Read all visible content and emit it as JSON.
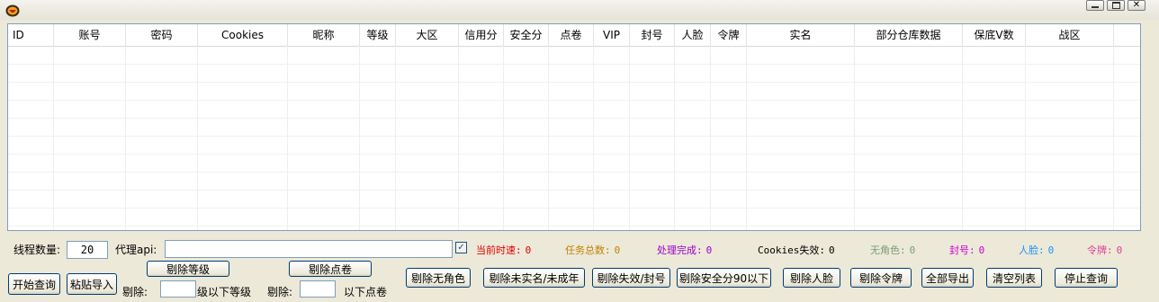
{
  "window": {
    "controls": [
      "minimize",
      "maximize",
      "close"
    ]
  },
  "table": {
    "columns": [
      "ID",
      "账号",
      "密码",
      "Cookies",
      "昵称",
      "等级",
      "大区",
      "信用分",
      "安全分",
      "点卷",
      "VIP",
      "封号",
      "人脸",
      "令牌",
      "实名",
      "部分仓库数据",
      "保底V数",
      "战区"
    ],
    "rows": []
  },
  "settings": {
    "threads_label": "线程数量:",
    "threads_value": "20",
    "proxy_label": "代理api:",
    "proxy_value": "",
    "proxy_checked": true
  },
  "stats": [
    {
      "label": "当前时速:",
      "value": "0",
      "color": "#e00000"
    },
    {
      "label": "任务总数:",
      "value": "0",
      "color": "#c08000"
    },
    {
      "label": "处理完成:",
      "value": "0",
      "color": "#9a00c8"
    },
    {
      "label": "Cookies失效:",
      "value": "0",
      "color": "#000000"
    },
    {
      "label": "无角色:",
      "value": "0",
      "color": "#7a9a7a"
    },
    {
      "label": "封号:",
      "value": "0",
      "color": "#d000d0"
    },
    {
      "label": "人脸:",
      "value": "0",
      "color": "#1e90ff"
    },
    {
      "label": "令牌:",
      "value": "0",
      "color": "#e0409a"
    }
  ],
  "filters": {
    "remove_level_button": "剔除等级",
    "remove_level_prefix": "剔除:",
    "remove_level_value": "",
    "remove_level_suffix": "级以下等级",
    "remove_points_button": "剔除点卷",
    "remove_points_prefix": "剔除:",
    "remove_points_value": "",
    "remove_points_suffix": "以下点卷"
  },
  "buttons": {
    "start": "开始查询",
    "paste_import": "粘贴导入",
    "remove_no_role": "剔除无角色",
    "remove_unverified": "剔除未实名/未成年",
    "remove_invalid_banned": "剔除失效/封号",
    "remove_low_security": "剔除安全分90以下",
    "remove_face": "剔除人脸",
    "remove_token": "剔除令牌",
    "export_all": "全部导出",
    "clear_list": "清空列表",
    "stop": "停止查询"
  },
  "colors": {
    "window_bg": "#ece9d8",
    "grid_border": "#7f9db9",
    "button_border": "#003c74"
  }
}
